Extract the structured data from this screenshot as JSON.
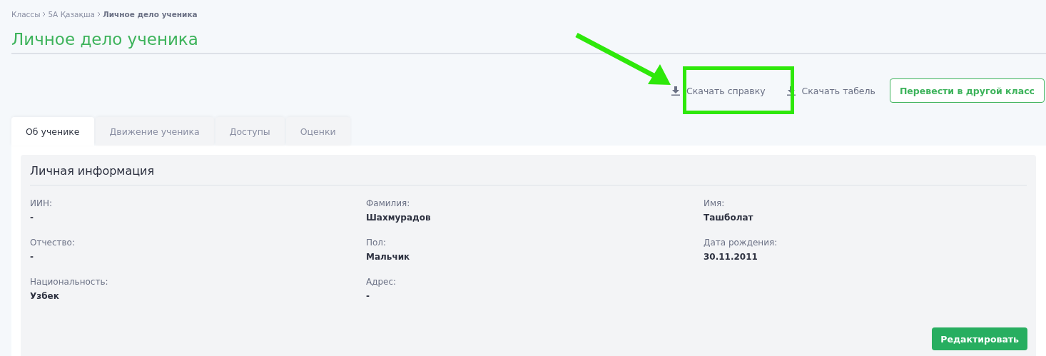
{
  "breadcrumb": [
    {
      "label": "Классы",
      "current": false
    },
    {
      "label": "5А Қазақша",
      "current": false
    },
    {
      "label": "Личное дело ученика",
      "current": true
    }
  ],
  "title": "Личное дело ученика",
  "actions": [
    {
      "label": "Скачать справку",
      "kind": "download"
    },
    {
      "label": "Скачать табель",
      "kind": "download"
    },
    {
      "label": "Перевести в другой класс",
      "kind": "outline"
    }
  ],
  "tabs": [
    {
      "label": "Об ученике",
      "selected": true
    },
    {
      "label": "Движение ученика",
      "selected": false
    },
    {
      "label": "Доступы",
      "selected": false
    },
    {
      "label": "Оценки",
      "selected": false
    }
  ],
  "section": {
    "title": "Личная информация",
    "fields": [
      {
        "label": "ИИН:",
        "value": "-"
      },
      {
        "label": "Фамилия:",
        "value": "Шахмурадов"
      },
      {
        "label": "Имя:",
        "value": "Ташболат"
      },
      {
        "label": "Отчество:",
        "value": "-"
      },
      {
        "label": "Пол:",
        "value": "Мальчик"
      },
      {
        "label": "Дата рождения:",
        "value": "30.11.2011"
      },
      {
        "label": "Национальность:",
        "value": "Узбек"
      },
      {
        "label": "Адрес:",
        "value": "-"
      }
    ],
    "button": "Редактировать"
  }
}
